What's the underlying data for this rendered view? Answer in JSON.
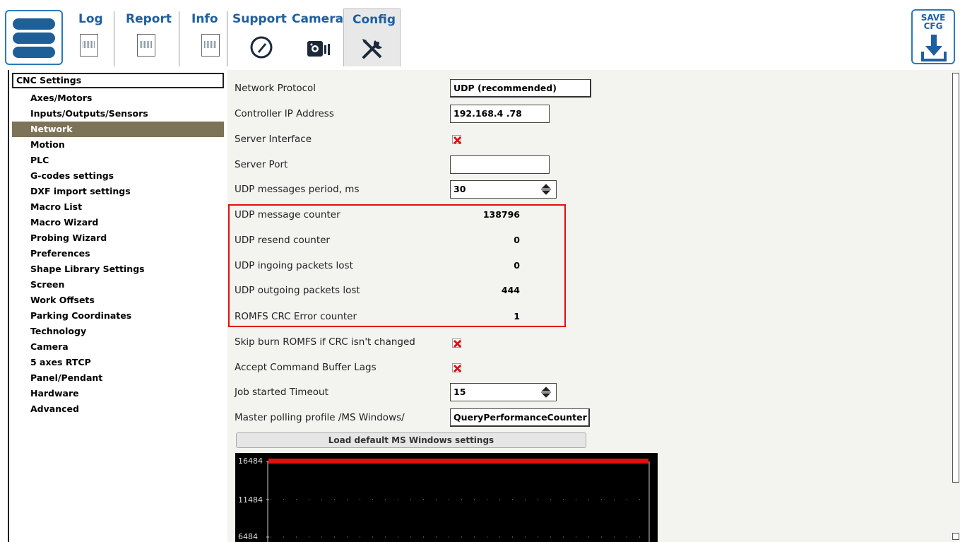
{
  "tabs": [
    {
      "label": "Log",
      "icon": "document-icon"
    },
    {
      "label": "Report",
      "icon": "document-icon"
    },
    {
      "label": "Info",
      "icon": "document-icon"
    },
    {
      "label": "Support",
      "icon": "phone-icon"
    },
    {
      "label": "Camera",
      "icon": "camera-icon"
    },
    {
      "label": "Config",
      "icon": "tools-icon",
      "active": true
    }
  ],
  "save_button": {
    "line1": "SAVE",
    "line2": "CFG",
    "icon": "download-icon"
  },
  "sidebar": {
    "header": "CNC Settings",
    "items": [
      {
        "label": "Axes/Motors"
      },
      {
        "label": "Inputs/Outputs/Sensors"
      },
      {
        "label": "Network",
        "selected": true
      },
      {
        "label": "Motion"
      },
      {
        "label": "PLC"
      },
      {
        "label": "G-codes settings"
      },
      {
        "label": "DXF import settings"
      },
      {
        "label": "Macro List"
      },
      {
        "label": "Macro Wizard"
      },
      {
        "label": "Probing Wizard"
      },
      {
        "label": "Preferences"
      },
      {
        "label": "Shape Library Settings"
      },
      {
        "label": "Screen"
      },
      {
        "label": "Work Offsets"
      },
      {
        "label": "Parking Coordinates"
      },
      {
        "label": "Technology"
      },
      {
        "label": "Camera"
      },
      {
        "label": "5 axes RTCP"
      },
      {
        "label": "Panel/Pendant"
      },
      {
        "label": "Hardware"
      },
      {
        "label": "Advanced"
      }
    ]
  },
  "settings": {
    "network_protocol": {
      "label": "Network Protocol",
      "value": "UDP (recommended)"
    },
    "controller_ip": {
      "label": "Controller IP Address",
      "value": "192.168.4 .78"
    },
    "server_interface": {
      "label": "Server Interface",
      "checked": true
    },
    "server_port": {
      "label": "Server Port",
      "value": ""
    },
    "udp_period": {
      "label": "UDP messages period, ms",
      "value": "30"
    },
    "udp_msg_counter": {
      "label": "UDP message counter",
      "value": "138796"
    },
    "udp_resend": {
      "label": "UDP resend counter",
      "value": "0"
    },
    "udp_in_lost": {
      "label": "UDP ingoing packets lost",
      "value": "0"
    },
    "udp_out_lost": {
      "label": "UDP outgoing packets lost",
      "value": "444"
    },
    "romfs_crc": {
      "label": "ROMFS CRC Error counter",
      "value": "1"
    },
    "skip_burn": {
      "label": "Skip burn ROMFS if CRC isn't changed",
      "checked": true
    },
    "accept_lags": {
      "label": "Accept Command Buffer Lags",
      "checked": true
    },
    "job_timeout": {
      "label": "Job started Timeout",
      "value": "15"
    },
    "polling_profile": {
      "label": "Master polling profile /MS Windows/",
      "value": "QueryPerformanceCounter"
    },
    "load_default": "Load default MS Windows settings"
  },
  "plot": {
    "y_labels": [
      "16484",
      "11484",
      "6484"
    ],
    "line_color": "#e01010"
  },
  "colors": {
    "accent": "#1f5fa0",
    "selected": "#7c7358",
    "highlight": "#e01010"
  }
}
